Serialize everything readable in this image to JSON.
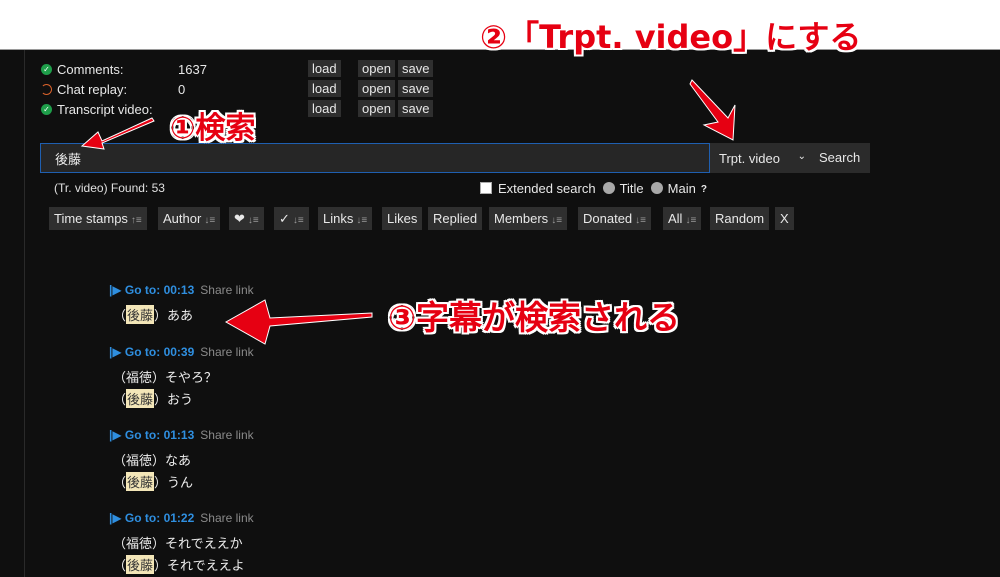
{
  "stats": [
    {
      "label": "Comments:",
      "value": "1637",
      "status": "ok",
      "status_icon": "check-circle-icon"
    },
    {
      "label": "Chat replay:",
      "value": "0",
      "status": "loading",
      "status_icon": "sync-icon"
    },
    {
      "label": "Transcript video:",
      "value": "",
      "status": "ok",
      "status_icon": "check-circle-icon"
    }
  ],
  "stat_buttons": {
    "load": "load",
    "open": "open",
    "save": "save"
  },
  "search": {
    "value": "後藤",
    "type_selected": "Trpt. video",
    "button": "Search"
  },
  "found_text": "(Tr. video) Found: 53",
  "options": {
    "extended_search": "Extended search",
    "extended_checked": false,
    "title": "Title",
    "main": "Main",
    "help": "?"
  },
  "filters": [
    {
      "label": "Time stamps",
      "sort": "asc"
    },
    {
      "label": "Author",
      "sort": "desc"
    },
    {
      "label": "❤",
      "sort": "desc"
    },
    {
      "label": "✓",
      "sort": "desc"
    },
    {
      "label": "Links",
      "sort": "desc"
    },
    {
      "label": "Likes",
      "sort": ""
    },
    {
      "label": "Replied",
      "sort": ""
    },
    {
      "label": "Members",
      "sort": "desc"
    },
    {
      "label": "Donated",
      "sort": "desc"
    },
    {
      "label": "All",
      "sort": "desc"
    },
    {
      "label": "Random",
      "sort": ""
    },
    {
      "label": "X",
      "sort": ""
    }
  ],
  "results": [
    {
      "goto": "|▶ Go to: 00:13",
      "share": "Share link",
      "lines": [
        {
          "speaker": "後藤",
          "highlight": true,
          "text": "ああ"
        }
      ]
    },
    {
      "goto": "|▶ Go to: 00:39",
      "share": "Share link",
      "lines": [
        {
          "speaker": "福徳",
          "highlight": false,
          "text": "そやろ？"
        },
        {
          "speaker": "後藤",
          "highlight": true,
          "text": "おう"
        }
      ]
    },
    {
      "goto": "|▶ Go to: 01:13",
      "share": "Share link",
      "lines": [
        {
          "speaker": "福徳",
          "highlight": false,
          "text": "なあ"
        },
        {
          "speaker": "後藤",
          "highlight": true,
          "text": "うん"
        }
      ]
    },
    {
      "goto": "|▶ Go to: 01:22",
      "share": "Share link",
      "lines": [
        {
          "speaker": "福徳",
          "highlight": false,
          "text": "それでええか"
        },
        {
          "speaker": "後藤",
          "highlight": true,
          "text": "それでええよ"
        }
      ]
    }
  ],
  "annotations": {
    "step1": "①検索",
    "step2": "②「Trpt. video」にする",
    "step3": "③字幕が検索される"
  },
  "colors": {
    "accent_link": "#2f8fe0",
    "annotation_red": "#e60012",
    "highlight": "#f3e6b8",
    "ok_green": "#1e9e4a",
    "sync_orange": "#d9622b"
  }
}
